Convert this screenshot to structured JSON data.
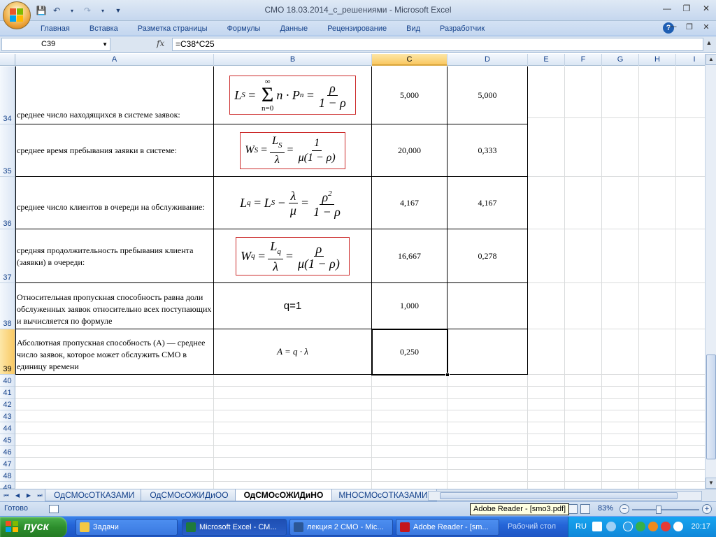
{
  "window": {
    "title": "СМО 18.03.2014_с_решениями - Microsoft Excel"
  },
  "ribbon": {
    "tabs": [
      "Главная",
      "Вставка",
      "Разметка страницы",
      "Формулы",
      "Данные",
      "Рецензирование",
      "Вид",
      "Разработчик"
    ]
  },
  "formula_bar": {
    "name_box": "C39",
    "fx": "fx",
    "formula": "=C38*C25"
  },
  "columns": [
    "A",
    "B",
    "C",
    "D",
    "E",
    "F",
    "G",
    "H",
    "I"
  ],
  "selected_column": "C",
  "rows": [
    {
      "num": "34",
      "label": "среднее число находящихся в системе заявок:",
      "c": "5,000",
      "d": "5,000"
    },
    {
      "num": "35",
      "label": "среднее время пребывания заявки в системе:",
      "c": "20,000",
      "d": "0,333"
    },
    {
      "num": "36",
      "label": "среднее число клиентов в очереди на обслуживание:",
      "c": "4,167",
      "d": "4,167"
    },
    {
      "num": "37",
      "label": "средняя продолжительность пребывания клиента (заявки) в очереди:",
      "c": "16,667",
      "d": "0,278"
    },
    {
      "num": "38",
      "label": "Относительная пропускная способность равна доли обслуженных заявок относительно всех поступающих и вычисляется по формуле",
      "b": "q=1",
      "c": "1,000",
      "d": ""
    },
    {
      "num": "39",
      "label": "Абсолютная пропускная способность (А) — среднее число заявок, которое может обслужить СМО в единицу времени",
      "b": "A = q · λ",
      "c": "0,250",
      "d": ""
    }
  ],
  "empty_rows": [
    "40",
    "41",
    "42",
    "43",
    "44",
    "45",
    "46",
    "47",
    "48",
    "49"
  ],
  "selected_row": "39",
  "formulas": {
    "ls": {
      "lhs": "L",
      "lhs_sub": "S",
      "sum_top": "∞",
      "sum_bottom": "n=0",
      "term": "n · P",
      "term_sub": "n",
      "num": "ρ",
      "den": "1 − ρ"
    },
    "ws": {
      "lhs": "W",
      "lhs_sub": "S",
      "num1": "L",
      "num1_sub": "S",
      "den1": "λ",
      "num2": "1",
      "den2": "μ(1 − ρ)"
    },
    "lq": {
      "lhs": "L",
      "lhs_sub": "q",
      "rhs1": "L",
      "rhs1_sub": "S",
      "num1": "λ",
      "den1": "μ",
      "num2": "ρ",
      "num2_sup": "2",
      "den2": "1 − ρ"
    },
    "wq": {
      "lhs": "W",
      "lhs_sub": "q",
      "num1": "L",
      "num1_sub": "q",
      "den1": "λ",
      "num2": "ρ",
      "den2": "μ(1 − ρ)"
    }
  },
  "sheet_tabs": [
    "ОдСМОсОТКАЗАМИ",
    "ОдСМОсОЖИДиОО",
    "ОдСМОсОЖИДиНО",
    "МНОСМОсОТКАЗАМИ"
  ],
  "active_sheet": "ОдСМОсОЖИДиНО",
  "status": {
    "ready": "Готово",
    "tooltip": "Adobe Reader - [smo3.pdf]",
    "zoom": "83%"
  },
  "taskbar": {
    "start": "пуск",
    "tasks": [
      "Задачи",
      "Microsoft Excel - СМ...",
      "лекция 2 СМО - Mic...",
      "Adobe Reader - [sm..."
    ],
    "desktop": "Рабочий стол",
    "lang": "RU",
    "clock": "20:17"
  },
  "colors": {
    "accent": "#15428b",
    "formula_border": "#cc2b2b",
    "taskbar": "#2565d8",
    "start": "#2d8e2d"
  }
}
